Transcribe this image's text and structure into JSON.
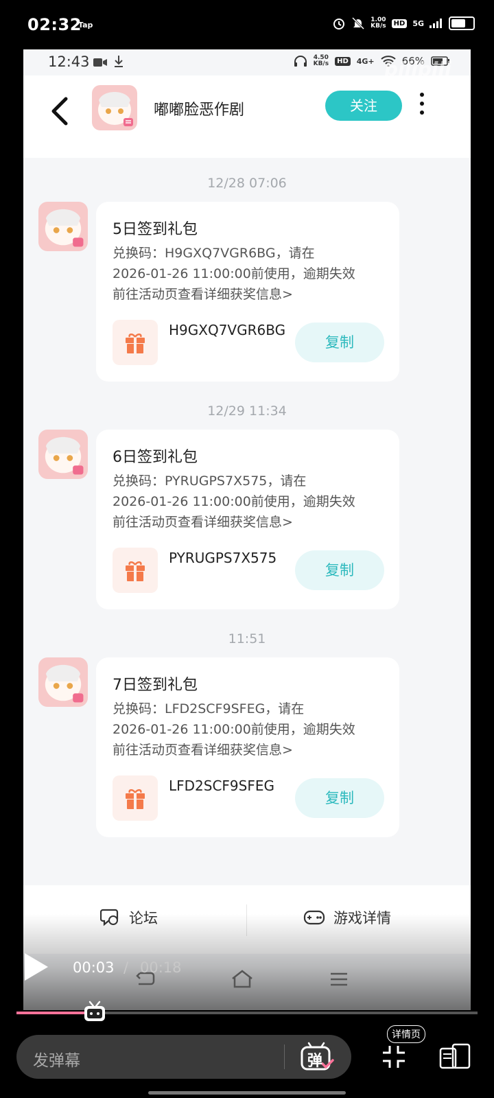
{
  "outer_status": {
    "time": "02:32",
    "tap": "Tap",
    "speed_value": "1.00",
    "speed_unit": "KB/s",
    "hd": "HD",
    "network": "5G"
  },
  "inner_status": {
    "time": "12:43",
    "speed_value": "4.50",
    "speed_unit": "KB/s",
    "hd": "HD",
    "network": "4G+",
    "battery": "66%"
  },
  "header": {
    "title": "嘟嘟脸恶作剧",
    "follow_label": "关注"
  },
  "messages": [
    {
      "timestamp": "12/28  07:06",
      "title": "5日签到礼包",
      "line1": "兑换码：H9GXQ7VGR6BG，请在",
      "line2": "2026-01-26 11:00:00前使用，逾期失效",
      "line3": "前往活动页查看详细获奖信息>",
      "code": "H9GXQ7VGR6BG",
      "copy_label": "复制"
    },
    {
      "timestamp": "12/29  11:34",
      "title": "6日签到礼包",
      "line1": "兑换码：PYRUGPS7X575，请在",
      "line2": "2026-01-26 11:00:00前使用，逾期失效",
      "line3": "前往活动页查看详细获奖信息>",
      "code": "PYRUGPS7X575",
      "copy_label": "复制"
    },
    {
      "timestamp": "11:51",
      "title": "7日签到礼包",
      "line1": "兑换码：LFD2SCF9SFEG，请在",
      "line2": "2026-01-26 11:00:00前使用，逾期失效",
      "line3": "前往活动页查看详细获奖信息>",
      "code": "LFD2SCF9SFEG",
      "copy_label": "复制"
    }
  ],
  "bottom_tabs": {
    "forum": "论坛",
    "game_detail": "游戏详情"
  },
  "player": {
    "current_time": "00:03",
    "separator": "/",
    "total_time": "00:18",
    "progress": 0.17,
    "danmaku_placeholder": "发弹幕",
    "danmaku_button": "弹",
    "detail_page_label": "详情页"
  },
  "watermark": "bilibili",
  "colors": {
    "accent": "#2cc6c6",
    "copy_text": "#2cb9bd",
    "gift": "#f47a4a",
    "progress": "#fb7299"
  }
}
